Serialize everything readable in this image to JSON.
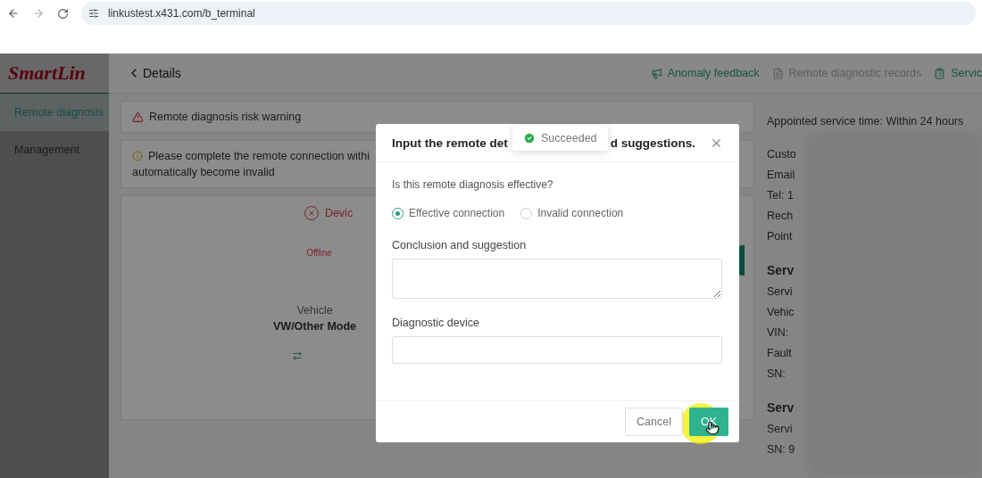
{
  "browser": {
    "url": "linkustest.x431.com/b_terminal"
  },
  "sidebar": {
    "logo": "SmartLin",
    "items": [
      {
        "label": "Remote diagnosis",
        "selected": true
      },
      {
        "label": "Management",
        "selected": false
      }
    ]
  },
  "header": {
    "back": "Details",
    "links": [
      {
        "label": "Anomaly feedback",
        "disabled": false
      },
      {
        "label": "Remote diagnostic records",
        "disabled": true
      },
      {
        "label": "Servic",
        "disabled": false
      }
    ]
  },
  "warning": {
    "title": "Remote diagnosis risk warning"
  },
  "notice": {
    "lines": [
      "Please complete the remote connection withi",
      "automatically become invalid"
    ]
  },
  "device": {
    "status": "Devic",
    "state": "Offline",
    "vehicle_label": "Vehicle",
    "vehicle": "VW/Other Mode"
  },
  "details": {
    "appointed": "Appointed service time:  Within 24 hours",
    "groups": [
      {
        "items": [
          "Custo",
          "Email",
          "Tel:  1",
          "Rech",
          "Point"
        ]
      },
      {
        "heading": "Serv",
        "items": [
          "Servi",
          "Vehic",
          "VIN:",
          "Fault",
          "SN:"
        ]
      },
      {
        "heading": "Serv",
        "items": [
          "Servi",
          "SN:  9"
        ]
      }
    ]
  },
  "modal": {
    "title_parts": [
      "Input the remote det",
      "d suggestions."
    ],
    "question": "Is this remote diagnosis effective?",
    "options": [
      {
        "label": "Effective connection",
        "selected": true
      },
      {
        "label": "Invalid connection",
        "selected": false
      }
    ],
    "fields": [
      {
        "label": "Conclusion and suggestion",
        "kind": "textarea"
      },
      {
        "label": "Diagnostic device",
        "kind": "input"
      }
    ],
    "buttons": [
      {
        "label": "Cancel",
        "kind": "default"
      },
      {
        "label": "OK",
        "kind": "primary"
      }
    ]
  },
  "toast": {
    "text": "Succeeded"
  }
}
